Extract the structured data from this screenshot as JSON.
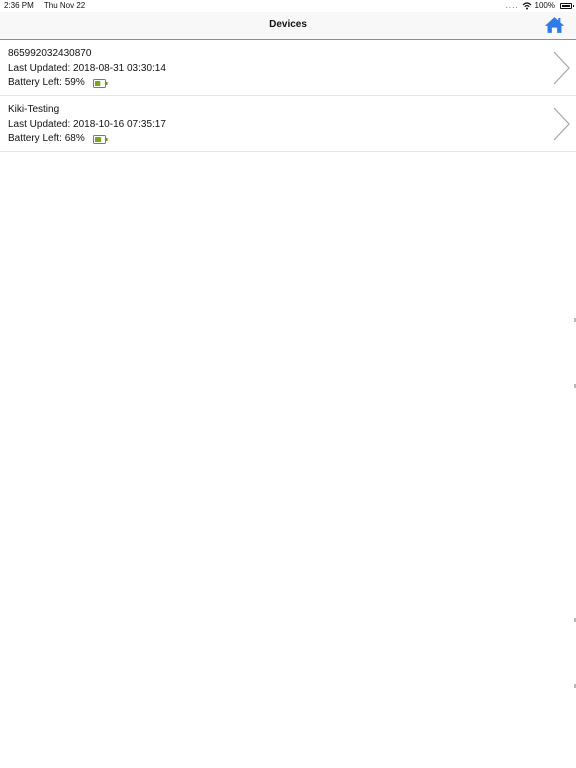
{
  "status_bar": {
    "time": "2:36 PM",
    "date": "Thu Nov 22",
    "signal_dots": "....",
    "battery_percent": "100%",
    "battery_level": 1.0
  },
  "nav": {
    "title": "Devices",
    "home_icon": "home-icon",
    "accent_color": "#2f7bea"
  },
  "devices": [
    {
      "name": "865992032430870",
      "last_updated": "Last Updated: 2018-08-31 03:30:14",
      "battery": "Battery Left: 59%",
      "battery_level": 0.59
    },
    {
      "name": "Kiki-Testing",
      "last_updated": "Last Updated: 2018-10-16 07:35:17",
      "battery": "Battery Left: 68%",
      "battery_level": 0.68
    }
  ],
  "colors": {
    "battery_fill": "#7aa61f",
    "chevron": "#a6a6a6"
  }
}
